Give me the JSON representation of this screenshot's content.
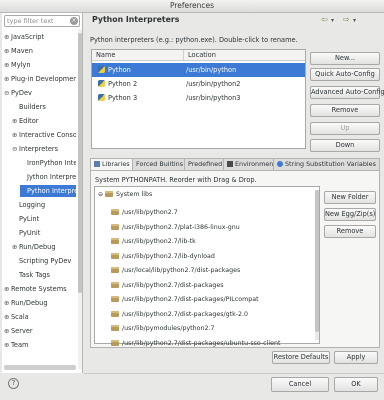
{
  "window": {
    "title": "Preferences"
  },
  "sidebar": {
    "filter_placeholder": "type filter text",
    "items": [
      {
        "label": "JavaScript",
        "expander": "⊕"
      },
      {
        "label": "Maven",
        "expander": "⊕"
      },
      {
        "label": "Mylyn",
        "expander": "⊕"
      },
      {
        "label": "Plug-in Development",
        "expander": "⊕"
      },
      {
        "label": "PyDev",
        "expander": "⊖"
      },
      {
        "label": "Builders",
        "expander": ""
      },
      {
        "label": "Editor",
        "expander": "⊕"
      },
      {
        "label": "Interactive Console",
        "expander": "⊕"
      },
      {
        "label": "Interpreters",
        "expander": "⊖"
      },
      {
        "label": "IronPython Interpreter",
        "expander": ""
      },
      {
        "label": "Jython Interpreter",
        "expander": ""
      },
      {
        "label": "Python Interpreter",
        "expander": ""
      },
      {
        "label": "Logging",
        "expander": ""
      },
      {
        "label": "PyLint",
        "expander": ""
      },
      {
        "label": "PyUnit",
        "expander": ""
      },
      {
        "label": "Run/Debug",
        "expander": "⊕"
      },
      {
        "label": "Scripting PyDev",
        "expander": ""
      },
      {
        "label": "Task Tags",
        "expander": ""
      },
      {
        "label": "Remote Systems",
        "expander": "⊕"
      },
      {
        "label": "Run/Debug",
        "expander": "⊕"
      },
      {
        "label": "Scala",
        "expander": "⊕"
      },
      {
        "label": "Server",
        "expander": "⊕"
      },
      {
        "label": "Team",
        "expander": "⊕"
      }
    ]
  },
  "page": {
    "title": "Python Interpreters",
    "nav": {
      "back": "⇦",
      "back_menu": "▾",
      "forward": "⇨",
      "forward_menu": "▾"
    },
    "description": "Python interpreters (e.g.: python.exe).   Double-click to rename.",
    "table": {
      "headers": [
        "Name",
        "Location"
      ],
      "rows": [
        {
          "name": "Python",
          "location": "/usr/bin/python"
        },
        {
          "name": "Python 2",
          "location": "/usr/bin/python2"
        },
        {
          "name": "Python 3",
          "location": "/usr/bin/python3"
        }
      ]
    },
    "buttons": {
      "new": "New...",
      "quick": "Quick Auto-Config",
      "advanced": "Advanced Auto-Config",
      "remove": "Remove",
      "up": "Up",
      "down": "Down"
    },
    "tabs": [
      "Libraries",
      "Forced Builtins",
      "Predefined",
      "Environment",
      "String Substitution Variables"
    ],
    "libraries": {
      "label": "System PYTHONPATH.  Reorder with Drag & Drop.",
      "root": "System libs",
      "root_expander": "⊖",
      "paths": [
        "/usr/lib/python2.7",
        "/usr/lib/python2.7/plat-i386-linux-gnu",
        "/usr/lib/python2.7/lib-tk",
        "/usr/lib/python2.7/lib-dynload",
        "/usr/local/lib/python2.7/dist-packages",
        "/usr/lib/python2.7/dist-packages",
        "/usr/lib/python2.7/dist-packages/PILcompat",
        "/usr/lib/python2.7/dist-packages/gtk-2.0",
        "/usr/lib/pymodules/python2.7",
        "/usr/lib/python2.7/dist-packages/ubuntu-sso-client"
      ],
      "new_folder": "New Folder",
      "new_egg": "New Egg/Zip(s)",
      "remove": "Remove"
    },
    "restore_defaults": "Restore Defaults",
    "apply": "Apply"
  },
  "dialog": {
    "help": "?",
    "cancel": "Cancel",
    "ok": "OK"
  },
  "colors": {
    "selection": "#3c7ad5",
    "background": "#e8e8e7"
  }
}
